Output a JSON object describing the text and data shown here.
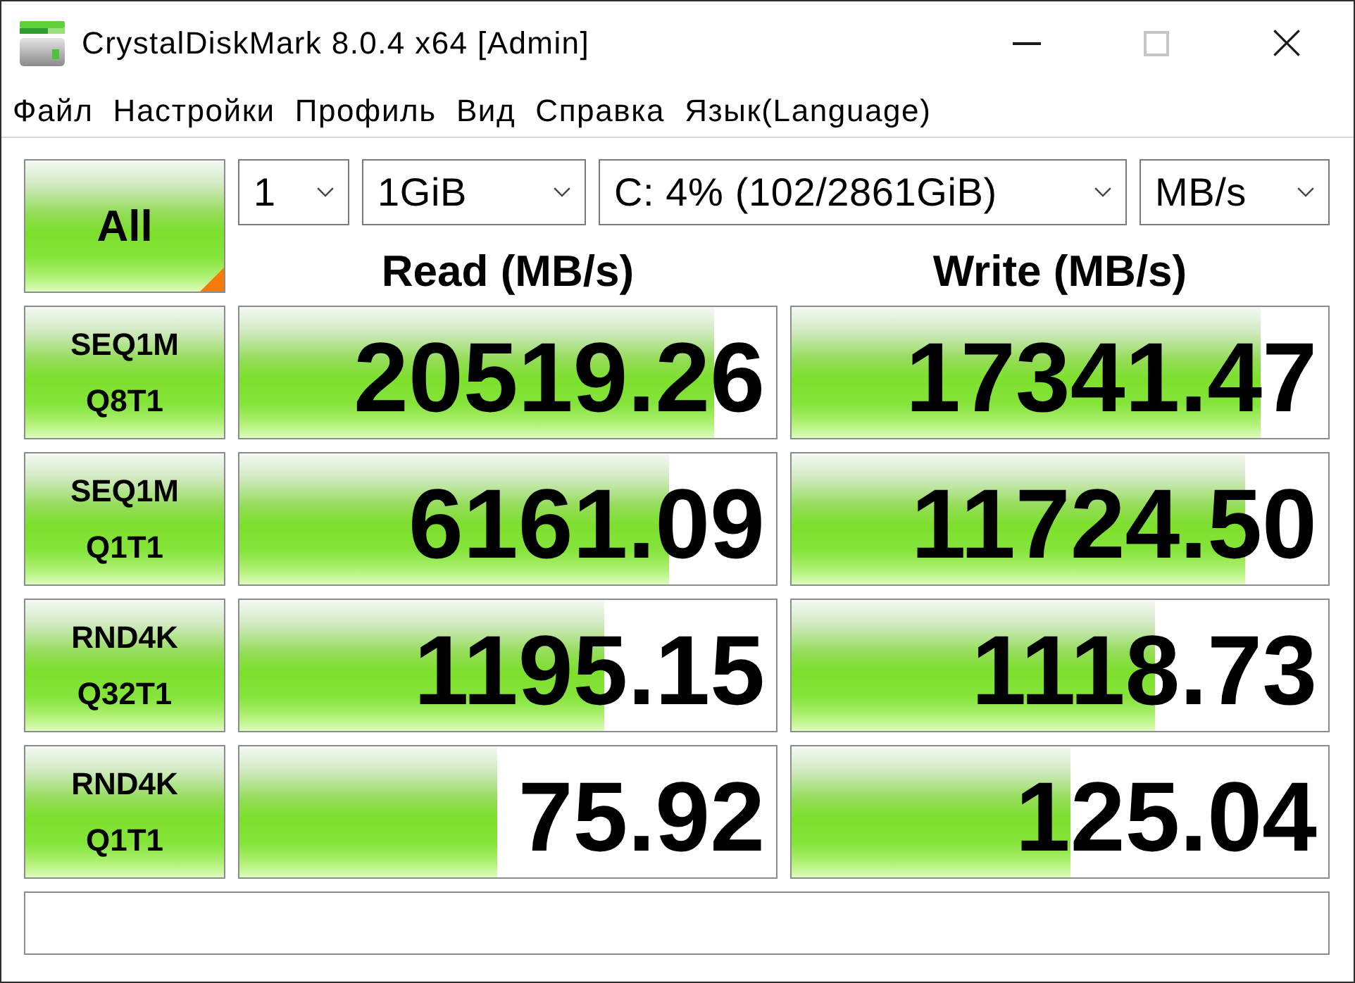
{
  "window": {
    "title": "CrystalDiskMark 8.0.4 x64 [Admin]",
    "controls": [
      {
        "kind": "minimize",
        "disabled": false
      },
      {
        "kind": "maximize",
        "disabled": true
      },
      {
        "kind": "close",
        "disabled": false
      }
    ]
  },
  "menu": [
    "Файл",
    "Настройки",
    "Профиль",
    "Вид",
    "Справка",
    "Язык(Language)"
  ],
  "toolbar": {
    "all_button": "All",
    "dropdowns": [
      "1",
      "1GiB",
      "C: 4% (102/2861GiB)",
      "MB/s"
    ]
  },
  "columns": [
    "Read (MB/s)",
    "Write (MB/s)"
  ],
  "tests": [
    {
      "label": [
        "SEQ1M",
        "Q8T1"
      ],
      "read": {
        "value": "20519.26",
        "level": 0.885
      },
      "write": {
        "value": "17341.47",
        "level": 0.875
      }
    },
    {
      "label": [
        "SEQ1M",
        "Q1T1"
      ],
      "read": {
        "value": "6161.09",
        "level": 0.8
      },
      "write": {
        "value": "11724.50",
        "level": 0.846
      }
    },
    {
      "label": [
        "RND4K",
        "Q32T1"
      ],
      "read": {
        "value": "1195.15",
        "level": 0.68
      },
      "write": {
        "value": "1118.73",
        "level": 0.676
      }
    },
    {
      "label": [
        "RND4K",
        "Q1T1"
      ],
      "read": {
        "value": "75.92",
        "level": 0.48
      },
      "write": {
        "value": "125.04",
        "level": 0.52
      }
    }
  ]
}
